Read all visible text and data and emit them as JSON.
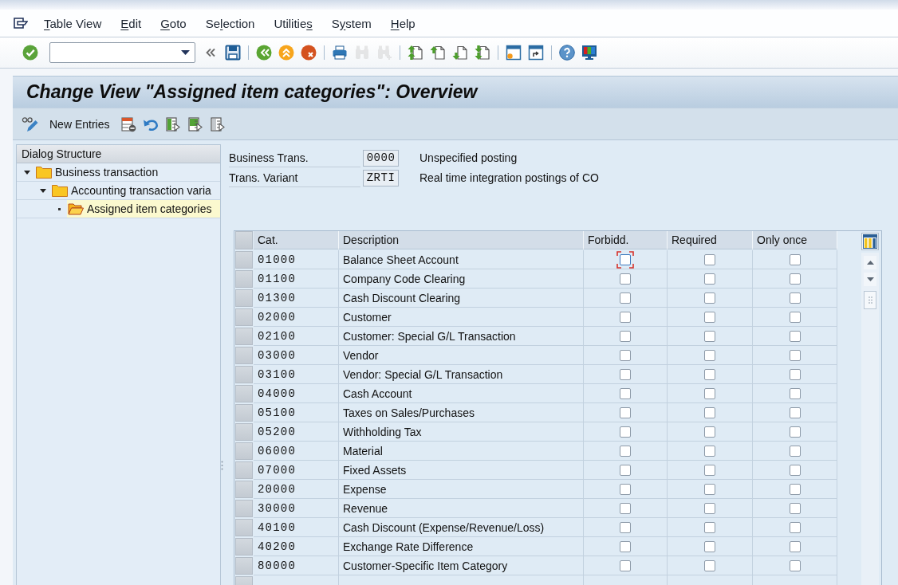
{
  "menu_bar": {
    "items": [
      {
        "key": "T",
        "post": "able View"
      },
      {
        "key": "E",
        "post": "dit"
      },
      {
        "key": "G",
        "post": "oto"
      },
      {
        "pre": "Se",
        "key": "l",
        "post": "ection"
      },
      {
        "pre": "Utilitie",
        "key": "s"
      },
      {
        "pre": "S",
        "key": "y",
        "post": "stem"
      },
      {
        "key": "H",
        "post": "elp"
      }
    ]
  },
  "toolbar": {
    "items": [
      {
        "kind": "enter",
        "disabled": false
      },
      {
        "kind": "command_field"
      },
      {
        "kind": "history",
        "disabled": false
      },
      {
        "kind": "save",
        "disabled": false
      },
      {
        "kind": "separator"
      },
      {
        "kind": "back",
        "disabled": false
      },
      {
        "kind": "exit",
        "disabled": false
      },
      {
        "kind": "cancel",
        "disabled": false
      },
      {
        "kind": "separator"
      },
      {
        "kind": "print",
        "disabled": false
      },
      {
        "kind": "find",
        "disabled": true
      },
      {
        "kind": "find_next",
        "disabled": true
      },
      {
        "kind": "separator"
      },
      {
        "kind": "first_page",
        "disabled": false
      },
      {
        "kind": "previous_page",
        "disabled": false
      },
      {
        "kind": "next_page",
        "disabled": false
      },
      {
        "kind": "last_page",
        "disabled": false
      },
      {
        "kind": "separator"
      },
      {
        "kind": "new_session",
        "disabled": false
      },
      {
        "kind": "shortcut",
        "disabled": false
      },
      {
        "kind": "separator"
      },
      {
        "kind": "help",
        "disabled": false
      },
      {
        "kind": "layout",
        "disabled": false
      }
    ]
  },
  "title_bar": {
    "title": "Change View \"Assigned item categories\": Overview"
  },
  "application_toolbar": {
    "items": [
      {
        "kind": "display_change"
      },
      {
        "kind": "text",
        "label": "New Entries"
      },
      {
        "kind": "delete"
      },
      {
        "kind": "undo"
      },
      {
        "kind": "select_all"
      },
      {
        "kind": "select_block"
      },
      {
        "kind": "deselect_all"
      }
    ]
  },
  "dialog_structure": {
    "title": "Dialog Structure",
    "tree": [
      {
        "label": "Business transaction",
        "expanded": true,
        "selected": false,
        "children": [
          {
            "label": "Accounting transaction varia",
            "expanded": true,
            "selected": false,
            "children": [
              {
                "label": "Assigned item categories",
                "selected": true
              }
            ]
          }
        ]
      }
    ]
  },
  "header_fields": [
    {
      "label": "Business Trans.",
      "value": "0000",
      "description": "Unspecified posting"
    },
    {
      "label": "Trans. Variant",
      "value": "ZRTI",
      "description": "Real time integration postings of CO"
    }
  ],
  "table": {
    "columns": [
      "Cat.",
      "Description",
      "Forbidd.",
      "Required",
      "Only once"
    ],
    "rows": [
      {
        "cat": "01000",
        "description": "Balance Sheet Account",
        "forbidden": false,
        "required": false,
        "only_once": false,
        "focused": true
      },
      {
        "cat": "01100",
        "description": "Company Code Clearing",
        "forbidden": false,
        "required": false,
        "only_once": false,
        "focused": false
      },
      {
        "cat": "01300",
        "description": "Cash Discount Clearing",
        "forbidden": false,
        "required": false,
        "only_once": false,
        "focused": false
      },
      {
        "cat": "02000",
        "description": "Customer",
        "forbidden": false,
        "required": false,
        "only_once": false,
        "focused": false
      },
      {
        "cat": "02100",
        "description": "Customer: Special G/L Transaction",
        "forbidden": false,
        "required": false,
        "only_once": false,
        "focused": false
      },
      {
        "cat": "03000",
        "description": "Vendor",
        "forbidden": false,
        "required": false,
        "only_once": false,
        "focused": false
      },
      {
        "cat": "03100",
        "description": "Vendor: Special G/L Transaction",
        "forbidden": false,
        "required": false,
        "only_once": false,
        "focused": false
      },
      {
        "cat": "04000",
        "description": "Cash Account",
        "forbidden": false,
        "required": false,
        "only_once": false,
        "focused": false
      },
      {
        "cat": "05100",
        "description": "Taxes on Sales/Purchases",
        "forbidden": false,
        "required": false,
        "only_once": false,
        "focused": false
      },
      {
        "cat": "05200",
        "description": "Withholding Tax",
        "forbidden": false,
        "required": false,
        "only_once": false,
        "focused": false
      },
      {
        "cat": "06000",
        "description": "Material",
        "forbidden": false,
        "required": false,
        "only_once": false,
        "focused": false
      },
      {
        "cat": "07000",
        "description": "Fixed Assets",
        "forbidden": false,
        "required": false,
        "only_once": false,
        "focused": false
      },
      {
        "cat": "20000",
        "description": "Expense",
        "forbidden": false,
        "required": false,
        "only_once": false,
        "focused": false
      },
      {
        "cat": "30000",
        "description": "Revenue",
        "forbidden": false,
        "required": false,
        "only_once": false,
        "focused": false
      },
      {
        "cat": "40100",
        "description": "Cash Discount (Expense/Revenue/Loss)",
        "forbidden": false,
        "required": false,
        "only_once": false,
        "focused": false
      },
      {
        "cat": "40200",
        "description": "Exchange Rate Difference",
        "forbidden": false,
        "required": false,
        "only_once": false,
        "focused": false
      },
      {
        "cat": "80000",
        "description": "Customer-Specific Item Category",
        "forbidden": false,
        "required": false,
        "only_once": false,
        "focused": false
      }
    ]
  }
}
